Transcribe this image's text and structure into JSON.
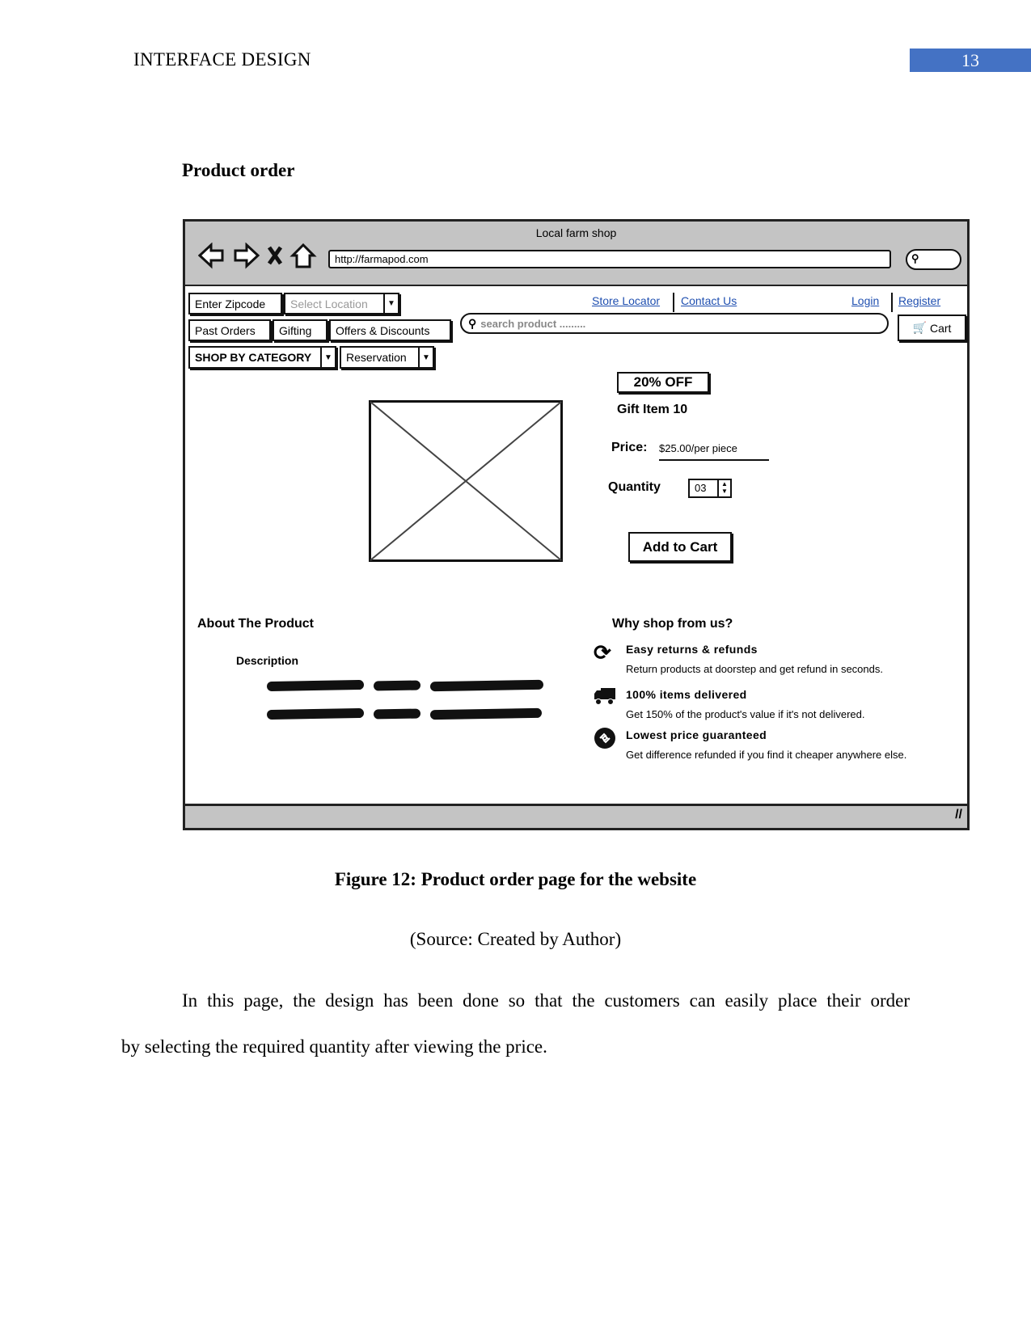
{
  "header": {
    "running_head": "INTERFACE DESIGN",
    "page_number": "13",
    "accent": "#4472c4"
  },
  "section_title": "Product order",
  "wireframe": {
    "window_title": "Local farm shop",
    "url": "http://farmapod.com",
    "nav_icons": [
      "back-arrow-icon",
      "forward-arrow-icon",
      "close-x-icon",
      "home-icon"
    ],
    "zipcode_label": "Enter Zipcode",
    "location_select": "Select Location",
    "links": {
      "store_locator": "Store Locator",
      "contact_us": "Contact Us",
      "login": "Login",
      "register": "Register"
    },
    "tabs": [
      "Past Orders",
      "Gifting",
      "Offers & Discounts"
    ],
    "search_placeholder": "search product .........",
    "cart_label": "Cart",
    "category_select": "SHOP BY CATEGORY",
    "reservation_select": "Reservation",
    "badge": "20% OFF",
    "product_name": "Gift Item 10",
    "price_label": "Price:",
    "price_value": "$25.00/per piece",
    "quantity_label": "Quantity",
    "quantity_value": "03",
    "add_to_cart": "Add to Cart",
    "about_title": "About The Product",
    "description_label": "Description",
    "why_title": "Why shop from us?",
    "features": [
      {
        "icon": "refresh-icon",
        "title": "Easy returns & refunds",
        "text": "Return products at doorstep and get refund in seconds."
      },
      {
        "icon": "truck-icon",
        "title": "100% items delivered",
        "text": "Get 150% of the product's value if it's not delivered."
      },
      {
        "icon": "price-tag-icon",
        "title": "Lowest price guaranteed",
        "text": "Get difference refunded if you find it cheaper anywhere else."
      }
    ]
  },
  "caption": "Figure 12: Product order page for the website",
  "source": "(Source: Created by Author)",
  "paragraph_line1": "In this page, the design has been done so that the customers can easily place their order",
  "paragraph_line2": "by selecting the required quantity after viewing the price."
}
